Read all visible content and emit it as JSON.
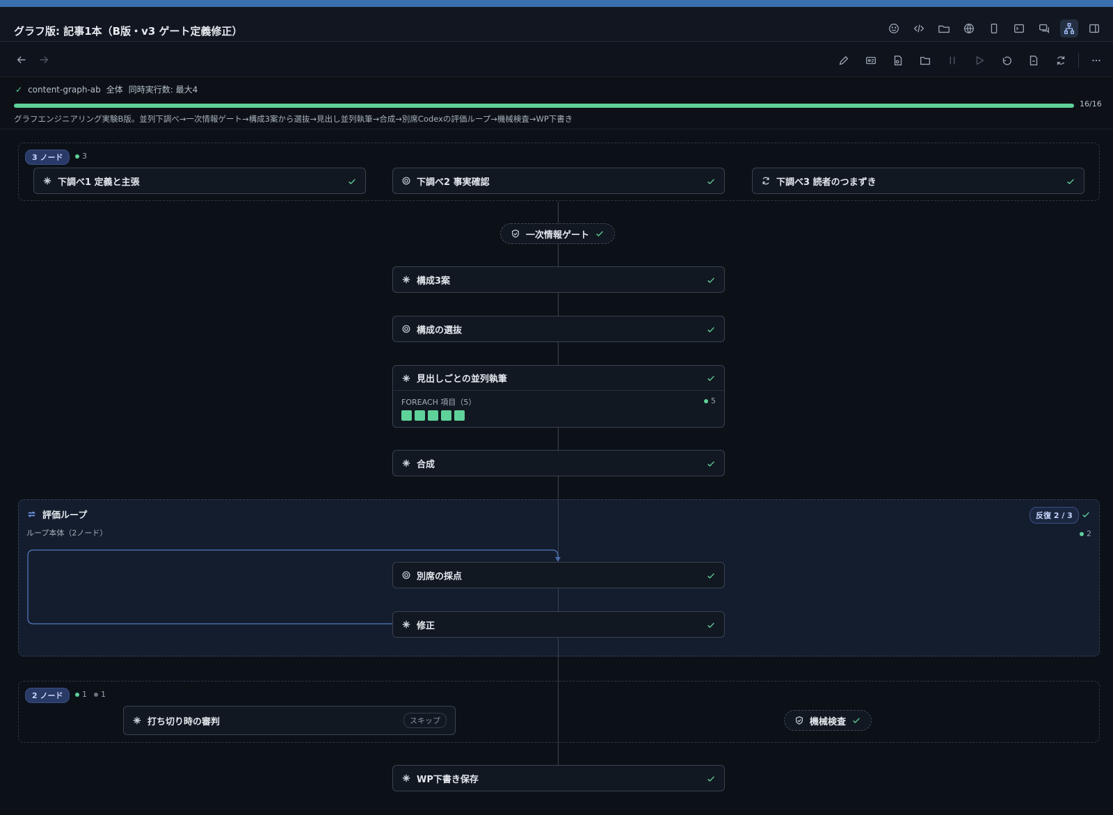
{
  "window": {
    "title": "グラフ版: 記事1本（B版・v3 ゲート定義修正）"
  },
  "title_icons": [
    "smiley-icon",
    "code-icon",
    "folder-open-icon",
    "globe-icon",
    "phone-icon",
    "terminal-icon",
    "chat-icon",
    "graph-icon",
    "sidebar-icon"
  ],
  "toolbar_icons": [
    "edit-icon",
    "id-card-icon",
    "file-icon",
    "folder-icon",
    "pause-icon",
    "play-icon",
    "undo-icon",
    "document-icon",
    "refresh-icon",
    "more-icon"
  ],
  "status": {
    "name": "content-graph-ab",
    "scope": "全体",
    "concurrency": "同時実行数: 最大4",
    "progress_label": "16/16",
    "progress_fraction": 1.0,
    "description": "グラフエンジニアリング実験B版。並列下調べ→一次情報ゲート→構成3案から選抜→見出し並列執筆→合成→別席Codexの評価ループ→機械検査→WP下書き"
  },
  "group1": {
    "pill": "3 ノード",
    "count": "3",
    "nodes": [
      {
        "label": "下調べ1 定義と主張",
        "icon": "sparkle-icon"
      },
      {
        "label": "下調べ2 事実確認",
        "icon": "openai-icon"
      },
      {
        "label": "下調べ3 読者のつまずき",
        "icon": "cycle-icon"
      }
    ]
  },
  "gate1": {
    "label": "一次情報ゲート"
  },
  "chain": [
    {
      "label": "構成3案",
      "icon": "sparkle-icon"
    },
    {
      "label": "構成の選抜",
      "icon": "openai-icon"
    }
  ],
  "foreach": {
    "label": "見出しごとの並列執筆",
    "sub": "FOREACH 項目（5）",
    "count": "5",
    "items": 5
  },
  "synth": {
    "label": "合成"
  },
  "loop": {
    "title": "評価ループ",
    "sub": "ループ本体（2ノード）",
    "iteration": "反復 2 / 3",
    "count": "2",
    "nodes": [
      {
        "label": "別席の採点",
        "icon": "openai-icon"
      },
      {
        "label": "修正",
        "icon": "sparkle-icon"
      }
    ]
  },
  "group2": {
    "pill": "2 ノード",
    "count_done": "1",
    "count_skipped": "1",
    "judge": {
      "label": "打ち切り時の審判",
      "badge": "スキップ"
    },
    "check": {
      "label": "機械検査"
    }
  },
  "final": {
    "label": "WP下書き保存"
  },
  "colors": {
    "accent": "#5fd19a",
    "pill": "#2a3a66",
    "loop_bg": "#141d2d",
    "link": "#7aa2ff"
  }
}
